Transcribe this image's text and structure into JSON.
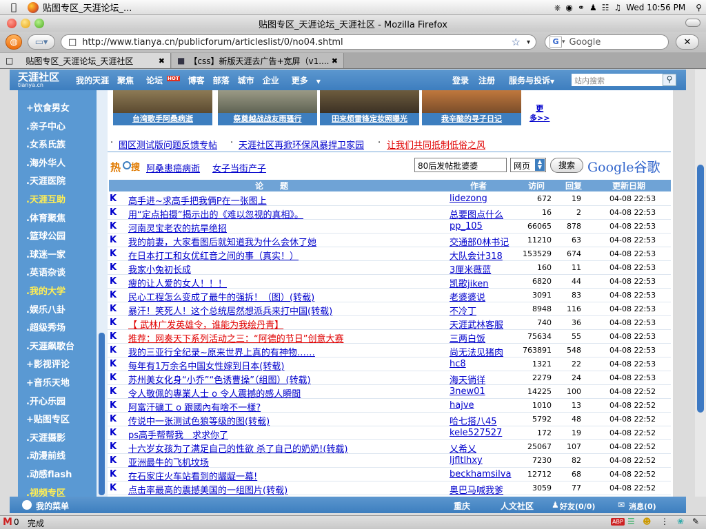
{
  "menubar": {
    "app_title": "贴图专区_天涯论坛_...",
    "clock": "Wed 10:56 PM"
  },
  "window": {
    "title": "贴图专区_天涯论坛_天涯社区 - Mozilla Firefox"
  },
  "navbar": {
    "url": "http://www.tianya.cn/publicforum/articleslist/0/no04.shtml",
    "search_placeholder": "Google",
    "engine_letter": "G"
  },
  "tabs": [
    {
      "label": "贴图专区_天涯论坛_天涯社区"
    },
    {
      "label": "【css】新版天涯去广告+宽屏（v1...."
    }
  ],
  "site_header": {
    "logo": "天涯社区",
    "logo_sub": "tianya.cn",
    "nav": [
      "我的天涯",
      "聚焦",
      "论坛",
      "博客",
      "部落",
      "城市",
      "企业",
      "更多"
    ],
    "hot_badge": "HOT",
    "login": "登录",
    "register": "注册",
    "services": "服务与投诉",
    "search_placeholder": "站内搜索"
  },
  "sidebar": {
    "items": [
      {
        "label": "+饮食男女",
        "highlight": false
      },
      {
        "label": ".亲子中心",
        "highlight": false
      },
      {
        "label": ".女系氏族",
        "highlight": false
      },
      {
        "label": ".海外华人",
        "highlight": false
      },
      {
        "label": ".天涯医院",
        "highlight": false
      },
      {
        "label": ".天涯互助",
        "highlight": true
      },
      {
        "label": ".体育聚焦",
        "highlight": false
      },
      {
        "label": ".篮球公园",
        "highlight": false
      },
      {
        "label": ".球迷一家",
        "highlight": false
      },
      {
        "label": ".英语杂谈",
        "highlight": false
      },
      {
        "label": ".我的大学",
        "highlight": true
      },
      {
        "label": ".娱乐八卦",
        "highlight": false
      },
      {
        "label": ".超级秀场",
        "highlight": false
      },
      {
        "label": ".天涯飙歌台",
        "highlight": false
      },
      {
        "label": "+影视评论",
        "highlight": false
      },
      {
        "label": "+音乐天地",
        "highlight": false
      },
      {
        "label": ".开心乐园",
        "highlight": false
      },
      {
        "label": "+贴图专区",
        "highlight": false
      },
      {
        "label": ".天涯摄影",
        "highlight": false
      },
      {
        "label": ".动漫前线",
        "highlight": false
      },
      {
        "label": ".动感flash",
        "highlight": false
      },
      {
        "label": ".视频专区",
        "highlight": true
      }
    ]
  },
  "thumbs": [
    {
      "caption": "台湾歌手阿桑病逝"
    },
    {
      "caption": "祭奠越战战友雨骚行"
    },
    {
      "caption": "田来烦雷锋定妆照曝光"
    },
    {
      "caption": "我辛酸的寻子日记"
    }
  ],
  "more_link": {
    "line1": "更",
    "line2": "多>>"
  },
  "notice": {
    "items": [
      "图区测试版问题反馈专帖",
      "天涯社区再掀环保风暴捍卫家园",
      "让我们共同抵制低俗之风"
    ]
  },
  "hot_search": {
    "label_left": "热",
    "label_right": "搜",
    "links": [
      "阿桑患癌病逝",
      "女子当街产子"
    ],
    "query": "80后发帖批婆婆",
    "scope": "网页",
    "button": "搜索",
    "brand": "Google谷歌"
  },
  "table": {
    "headers": {
      "title": "论　　题",
      "author": "作者",
      "visits": "访问",
      "replies": "回复",
      "updated": "更新日期"
    },
    "rows": [
      {
        "k": "K",
        "title": "高手进~求高手把我俩P在一张图上",
        "author": "lidezong",
        "visits": "672",
        "replies": "19",
        "date": "04-08 22:53",
        "red": false
      },
      {
        "k": "K",
        "title": "用“定点拍摄”揭示出的《难以忽视的真相》。",
        "author": "总要图点什么",
        "visits": "16",
        "replies": "2",
        "date": "04-08 22:53",
        "red": false
      },
      {
        "k": "K",
        "title": "河南灵宝老农的抗旱绝招",
        "author": "pp_105",
        "visits": "66065",
        "replies": "878",
        "date": "04-08 22:53",
        "red": false
      },
      {
        "k": "K",
        "title": "我的前妻，大家看图后就知道我为什么会休了她",
        "author": "交通部0林书记",
        "visits": "11210",
        "replies": "63",
        "date": "04-08 22:53",
        "red": false
      },
      {
        "k": "K",
        "title": "在日本打工和女优红音之间的事（真实！）",
        "author": "大队会计318",
        "visits": "153529",
        "replies": "674",
        "date": "04-08 22:53",
        "red": false
      },
      {
        "k": "K",
        "title": "我家小兔初长成",
        "author": "3厘米薇蓝",
        "visits": "160",
        "replies": "11",
        "date": "04-08 22:53",
        "red": false
      },
      {
        "k": "K",
        "title": "瘦的让人爱的女人！！！",
        "author": "凯歌jiken",
        "visits": "6820",
        "replies": "44",
        "date": "04-08 22:53",
        "red": false
      },
      {
        "k": "K",
        "title": "民心工程怎么变成了最牛的强拆！（图）(转载)",
        "author": "老婆婆说",
        "visits": "3091",
        "replies": "83",
        "date": "04-08 22:53",
        "red": false
      },
      {
        "k": "K",
        "title": "暴汗！笑死人！这个总统居然想派兵来打中国(转载)",
        "author": "不冷丁",
        "visits": "8948",
        "replies": "116",
        "date": "04-08 22:53",
        "red": false
      },
      {
        "k": "K",
        "title": "【 武林广发英雄令，谁能为我绘丹青】",
        "author": "天涯武林客服",
        "visits": "740",
        "replies": "36",
        "date": "04-08 22:53",
        "red": true
      },
      {
        "k": "K",
        "title": "推荐：网奏天下系列活动之三：“阿德的节日”创意大赛",
        "author": "三两白饭",
        "visits": "75634",
        "replies": "55",
        "date": "04-08 22:53",
        "red": true
      },
      {
        "k": "K",
        "title": "我的三亚行全纪录~原来世界上真的有神物……",
        "author": "尚无法见猪肉",
        "visits": "763891",
        "replies": "548",
        "date": "04-08 22:53",
        "red": false
      },
      {
        "k": "K",
        "title": "每年有1万余名中国女性嫁到日本(转载)",
        "author": "hc8",
        "visits": "1321",
        "replies": "22",
        "date": "04-08 22:53",
        "red": false
      },
      {
        "k": "K",
        "title": "苏州美女化身“小乔”“色诱曹操”（组图）(转载)",
        "author": "海天徜徉",
        "visits": "2279",
        "replies": "24",
        "date": "04-08 22:53",
        "red": false
      },
      {
        "k": "K",
        "title": "令人敬佩的專業人士 o 令人震撼的感人瞬間",
        "author": "3new01",
        "visits": "14225",
        "replies": "100",
        "date": "04-08 22:52",
        "red": false
      },
      {
        "k": "K",
        "title": "阿富汗礦工 o 跟國內有啥不一樣?",
        "author": "hajve",
        "visits": "1010",
        "replies": "13",
        "date": "04-08 22:52",
        "red": false
      },
      {
        "k": "K",
        "title": "传说中一张测试色狼等级的图(转载)",
        "author": "哈七搭八45",
        "visits": "5792",
        "replies": "48",
        "date": "04-08 22:52",
        "red": false
      },
      {
        "k": "K",
        "title": "ps高手帮帮我　求求你了",
        "author": "kele527527",
        "visits": "172",
        "replies": "19",
        "date": "04-08 22:52",
        "red": false
      },
      {
        "k": "K",
        "title": "十六岁女孩为了满足自己的性欲 杀了自己的奶奶!(转载)",
        "author": "乂希乂",
        "visits": "25067",
        "replies": "107",
        "date": "04-08 22:52",
        "red": false
      },
      {
        "k": "K",
        "title": "亚洲最牛的飞机坟场",
        "author": "ljfltlhxy",
        "visits": "7230",
        "replies": "82",
        "date": "04-08 22:52",
        "red": false
      },
      {
        "k": "K",
        "title": "在石家庄火车站看到的龌龊一幕!",
        "author": "beckhamsilva",
        "visits": "12712",
        "replies": "68",
        "date": "04-08 22:52",
        "red": false
      },
      {
        "k": "K",
        "title": "点击率最高的震撼美国的一组图片(转载)",
        "author": "奥巴马喊我爹",
        "visits": "3059",
        "replies": "77",
        "date": "04-08 22:52",
        "red": false
      }
    ]
  },
  "site_footer": {
    "my_menu": "我的菜单",
    "chongqing": "重庆",
    "community": "人文社区",
    "friends": "好友(0/0)",
    "messages": "消息(0)"
  },
  "statusbar": {
    "mail_count": "0",
    "status": "完成",
    "abp": "ABP"
  },
  "colors": {
    "header_blue": "#3d7ebf",
    "sidebar_blue": "#5a99d3",
    "link_blue": "#0000cc",
    "alert_red": "#e00000",
    "highlight_yellow": "#ffee55"
  }
}
